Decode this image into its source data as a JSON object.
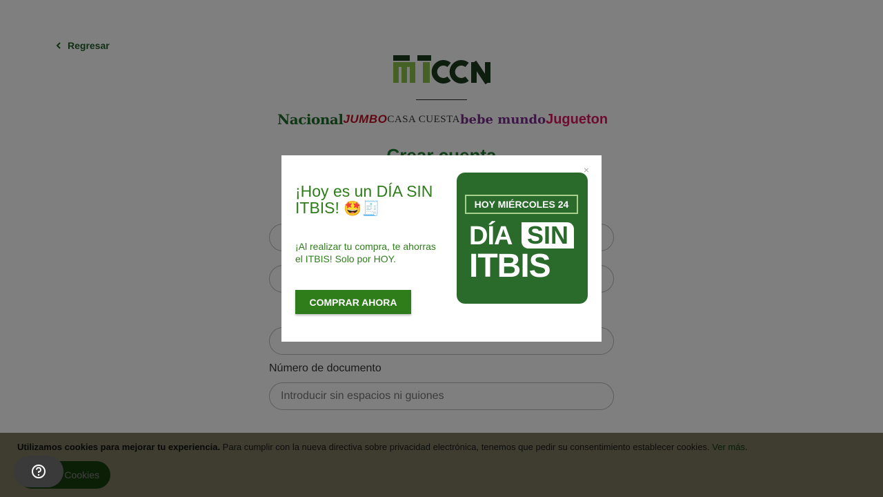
{
  "nav": {
    "back_label": "Regresar"
  },
  "brands": [
    "Nacional",
    "JUMBO",
    "CASA CUESTA",
    "bebe mundo",
    "Jugueton"
  ],
  "form": {
    "title": "Crear cuenta",
    "document_label": "Número de documento",
    "document_placeholder": "Introducir sin espacios ni guiones"
  },
  "modal": {
    "title": "¡Hoy es un DÍA SIN ITBIS!",
    "title_emoji": "🤩🧾",
    "body": "¡Al realizar tu compra, te ahorras el ITBIS! Solo por HOY.",
    "cta": "COMPRAR AHORA",
    "close": "×",
    "promo": {
      "tag": "HOY MIÉRCOLES 24",
      "dia": "DÍA",
      "sin": "SIN",
      "itbis": "ITBIS"
    }
  },
  "cookie": {
    "bold": "Utilizamos cookies para mejorar tu experiencia.",
    "text": " Para cumplir con la nueva directiva sobre privacidad electrónica, tenemos que pedir su consentimiento establecer cookies. ",
    "link": "Ver más",
    "link_suffix": ".",
    "button": "Cookies"
  },
  "colors": {
    "brand_green": "#2e7d1a",
    "dark_green": "#1f5f2a",
    "promo_green": "#2a6b2c",
    "cookie_bg": "#fff6bf"
  },
  "icons": {
    "back": "chevron-left-icon",
    "close": "close-icon",
    "help": "question-circle-icon"
  }
}
